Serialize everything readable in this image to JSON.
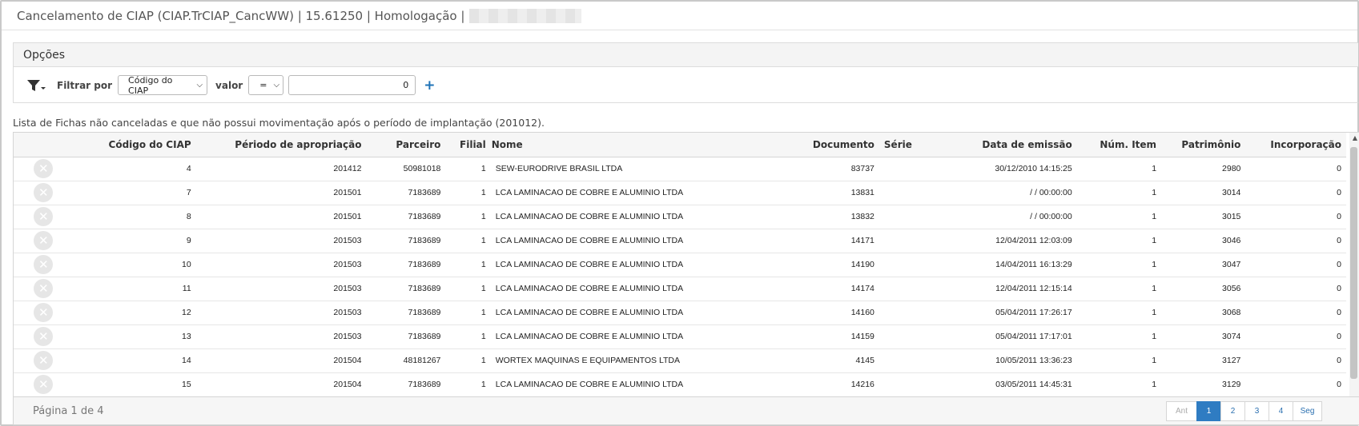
{
  "window": {
    "title": "Cancelamento de CIAP (CIAP.TrCIAP_CancWW) | 15.61250 | Homologação |"
  },
  "options": {
    "header": "Opções",
    "filter_label": "Filtrar por",
    "filter_field": "Código do CIAP",
    "value_label": "valor",
    "operator": "=",
    "value": "0",
    "add_symbol": "+"
  },
  "list": {
    "caption": "Lista de Fichas não canceladas e que não possui movimentação após o período de implantação (201012).",
    "columns": [
      "Código do CIAP",
      "Périodo de apropriação",
      "Parceiro",
      "Filial",
      "Nome",
      "Documento",
      "Série",
      "Data de emissão",
      "Núm. Item",
      "Patrimônio",
      "Incorporação"
    ],
    "rows": [
      {
        "codigo": "4",
        "periodo": "201412",
        "parceiro": "50981018",
        "filial": "1",
        "nome": "SEW-EURODRIVE BRASIL LTDA",
        "documento": "83737",
        "serie": "",
        "data": "30/12/2010 14:15:25",
        "item": "1",
        "patrimonio": "2980",
        "incorporacao": "0"
      },
      {
        "codigo": "7",
        "periodo": "201501",
        "parceiro": "7183689",
        "filial": "1",
        "nome": "LCA LAMINACAO DE COBRE E ALUMINIO LTDA",
        "documento": "13831",
        "serie": "",
        "data": "/ / 00:00:00",
        "item": "1",
        "patrimonio": "3014",
        "incorporacao": "0"
      },
      {
        "codigo": "8",
        "periodo": "201501",
        "parceiro": "7183689",
        "filial": "1",
        "nome": "LCA LAMINACAO DE COBRE E ALUMINIO LTDA",
        "documento": "13832",
        "serie": "",
        "data": "/ / 00:00:00",
        "item": "1",
        "patrimonio": "3015",
        "incorporacao": "0"
      },
      {
        "codigo": "9",
        "periodo": "201503",
        "parceiro": "7183689",
        "filial": "1",
        "nome": "LCA LAMINACAO DE COBRE E ALUMINIO LTDA",
        "documento": "14171",
        "serie": "",
        "data": "12/04/2011 12:03:09",
        "item": "1",
        "patrimonio": "3046",
        "incorporacao": "0"
      },
      {
        "codigo": "10",
        "periodo": "201503",
        "parceiro": "7183689",
        "filial": "1",
        "nome": "LCA LAMINACAO DE COBRE E ALUMINIO LTDA",
        "documento": "14190",
        "serie": "",
        "data": "14/04/2011 16:13:29",
        "item": "1",
        "patrimonio": "3047",
        "incorporacao": "0"
      },
      {
        "codigo": "11",
        "periodo": "201503",
        "parceiro": "7183689",
        "filial": "1",
        "nome": "LCA LAMINACAO DE COBRE E ALUMINIO LTDA",
        "documento": "14174",
        "serie": "",
        "data": "12/04/2011 12:15:14",
        "item": "1",
        "patrimonio": "3056",
        "incorporacao": "0"
      },
      {
        "codigo": "12",
        "periodo": "201503",
        "parceiro": "7183689",
        "filial": "1",
        "nome": "LCA LAMINACAO DE COBRE E ALUMINIO LTDA",
        "documento": "14160",
        "serie": "",
        "data": "05/04/2011 17:26:17",
        "item": "1",
        "patrimonio": "3068",
        "incorporacao": "0"
      },
      {
        "codigo": "13",
        "periodo": "201503",
        "parceiro": "7183689",
        "filial": "1",
        "nome": "LCA LAMINACAO DE COBRE E ALUMINIO LTDA",
        "documento": "14159",
        "serie": "",
        "data": "05/04/2011 17:17:01",
        "item": "1",
        "patrimonio": "3074",
        "incorporacao": "0"
      },
      {
        "codigo": "14",
        "periodo": "201504",
        "parceiro": "48181267",
        "filial": "1",
        "nome": "WORTEX MAQUINAS E EQUIPAMENTOS LTDA",
        "documento": "4145",
        "serie": "",
        "data": "10/05/2011 13:36:23",
        "item": "1",
        "patrimonio": "3127",
        "incorporacao": "0"
      },
      {
        "codigo": "15",
        "periodo": "201504",
        "parceiro": "7183689",
        "filial": "1",
        "nome": "LCA LAMINACAO DE COBRE E ALUMINIO LTDA",
        "documento": "14216",
        "serie": "",
        "data": "03/05/2011 14:45:31",
        "item": "1",
        "patrimonio": "3129",
        "incorporacao": "0"
      }
    ]
  },
  "pager": {
    "info": "Página 1 de 4",
    "prev": "Ant",
    "pages": [
      "1",
      "2",
      "3",
      "4"
    ],
    "active_page": "1",
    "next": "Seg"
  },
  "icons": {
    "filter": "funnel-icon",
    "row_action": "cancel-icon"
  },
  "colors": {
    "accent": "#2f7cc2",
    "link": "#2a6fb0"
  }
}
